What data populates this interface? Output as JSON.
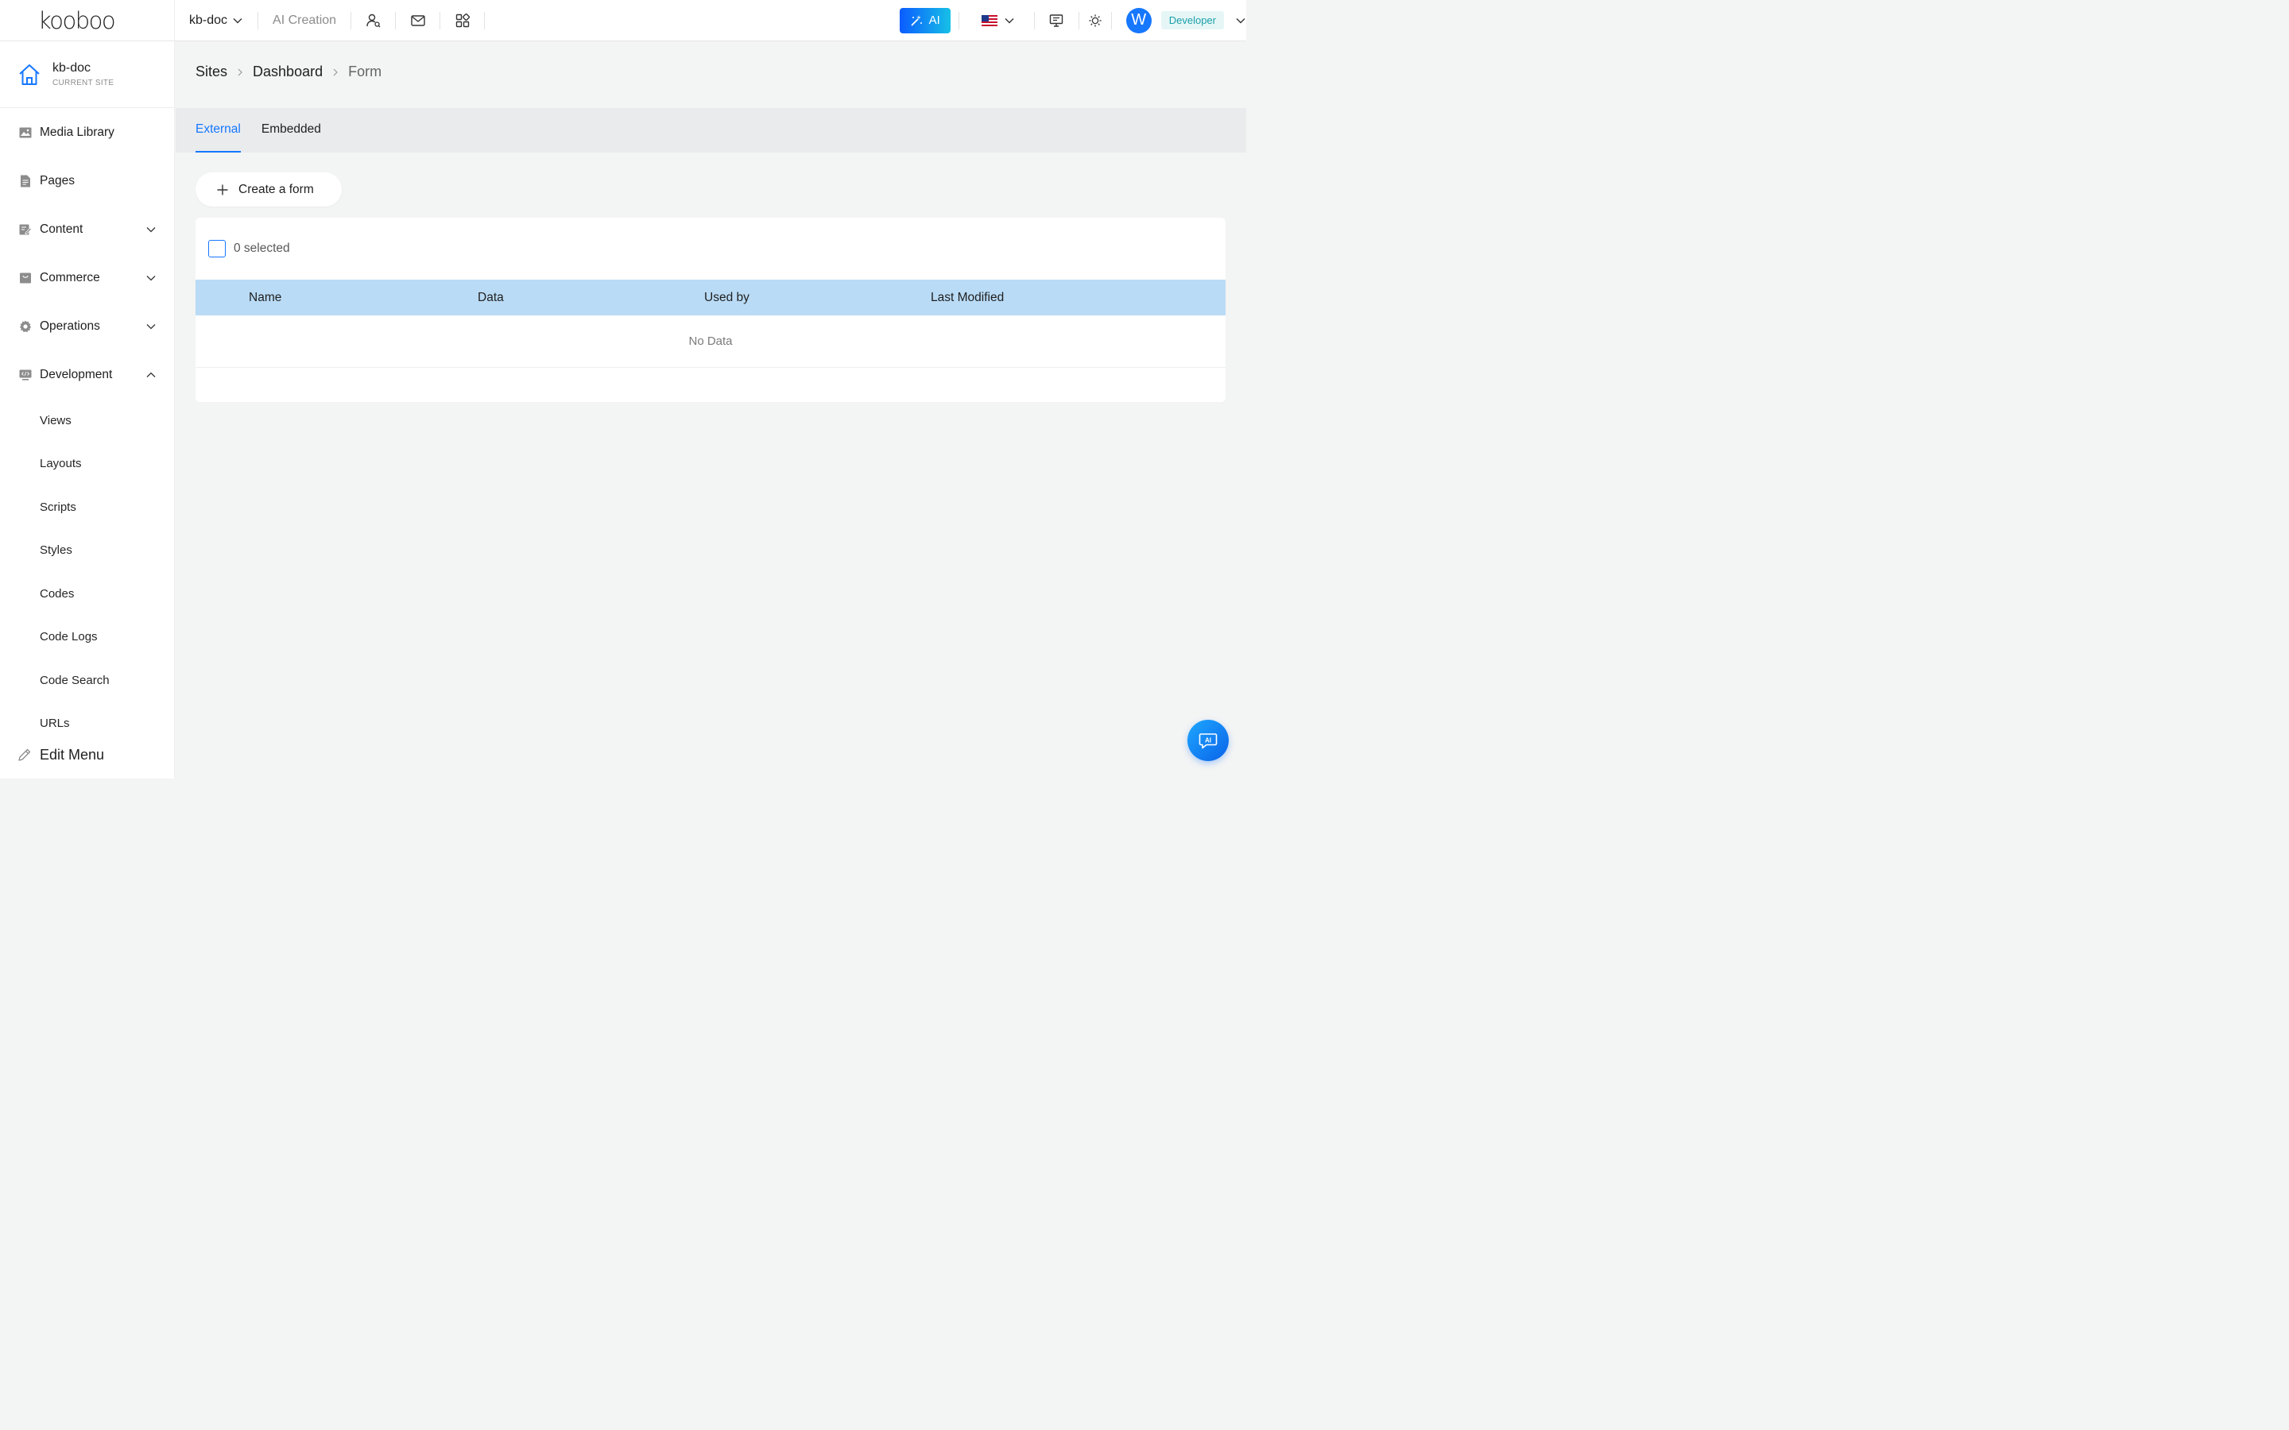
{
  "brand": {
    "logo_text": "kooboo"
  },
  "topbar": {
    "site_name": "kb-doc",
    "ai_creation": "AI Creation",
    "ai_button": "AI",
    "avatar_initial": "W",
    "role": "Developer"
  },
  "sidebar": {
    "current_site": {
      "name": "kb-doc",
      "caption": "CURRENT SITE"
    },
    "items": [
      {
        "label": "Media Library",
        "icon": "image-icon",
        "expandable": false
      },
      {
        "label": "Pages",
        "icon": "document-icon",
        "expandable": false
      },
      {
        "label": "Content",
        "icon": "edit-content-icon",
        "expandable": true,
        "expanded": false
      },
      {
        "label": "Commerce",
        "icon": "shopping-bag-icon",
        "expandable": true,
        "expanded": false
      },
      {
        "label": "Operations",
        "icon": "gear-icon",
        "expandable": true,
        "expanded": false
      },
      {
        "label": "Development",
        "icon": "code-monitor-icon",
        "expandable": true,
        "expanded": true
      }
    ],
    "dev_subitems": [
      "Views",
      "Layouts",
      "Scripts",
      "Styles",
      "Codes",
      "Code Logs",
      "Code Search",
      "URLs"
    ],
    "edit_menu": "Edit Menu"
  },
  "breadcrumb": {
    "sites": "Sites",
    "dashboard": "Dashboard",
    "current": "Form"
  },
  "tabs": [
    {
      "label": "External",
      "active": true
    },
    {
      "label": "Embedded",
      "active": false
    }
  ],
  "actions": {
    "create": "Create a form"
  },
  "table": {
    "selected_text": "0 selected",
    "columns": [
      "Name",
      "Data",
      "Used by",
      "Last Modified"
    ],
    "empty_text": "No Data"
  },
  "colors": {
    "primary": "#1677ff",
    "header_row": "#b9dbf6",
    "role_text": "#1aa0a8"
  }
}
